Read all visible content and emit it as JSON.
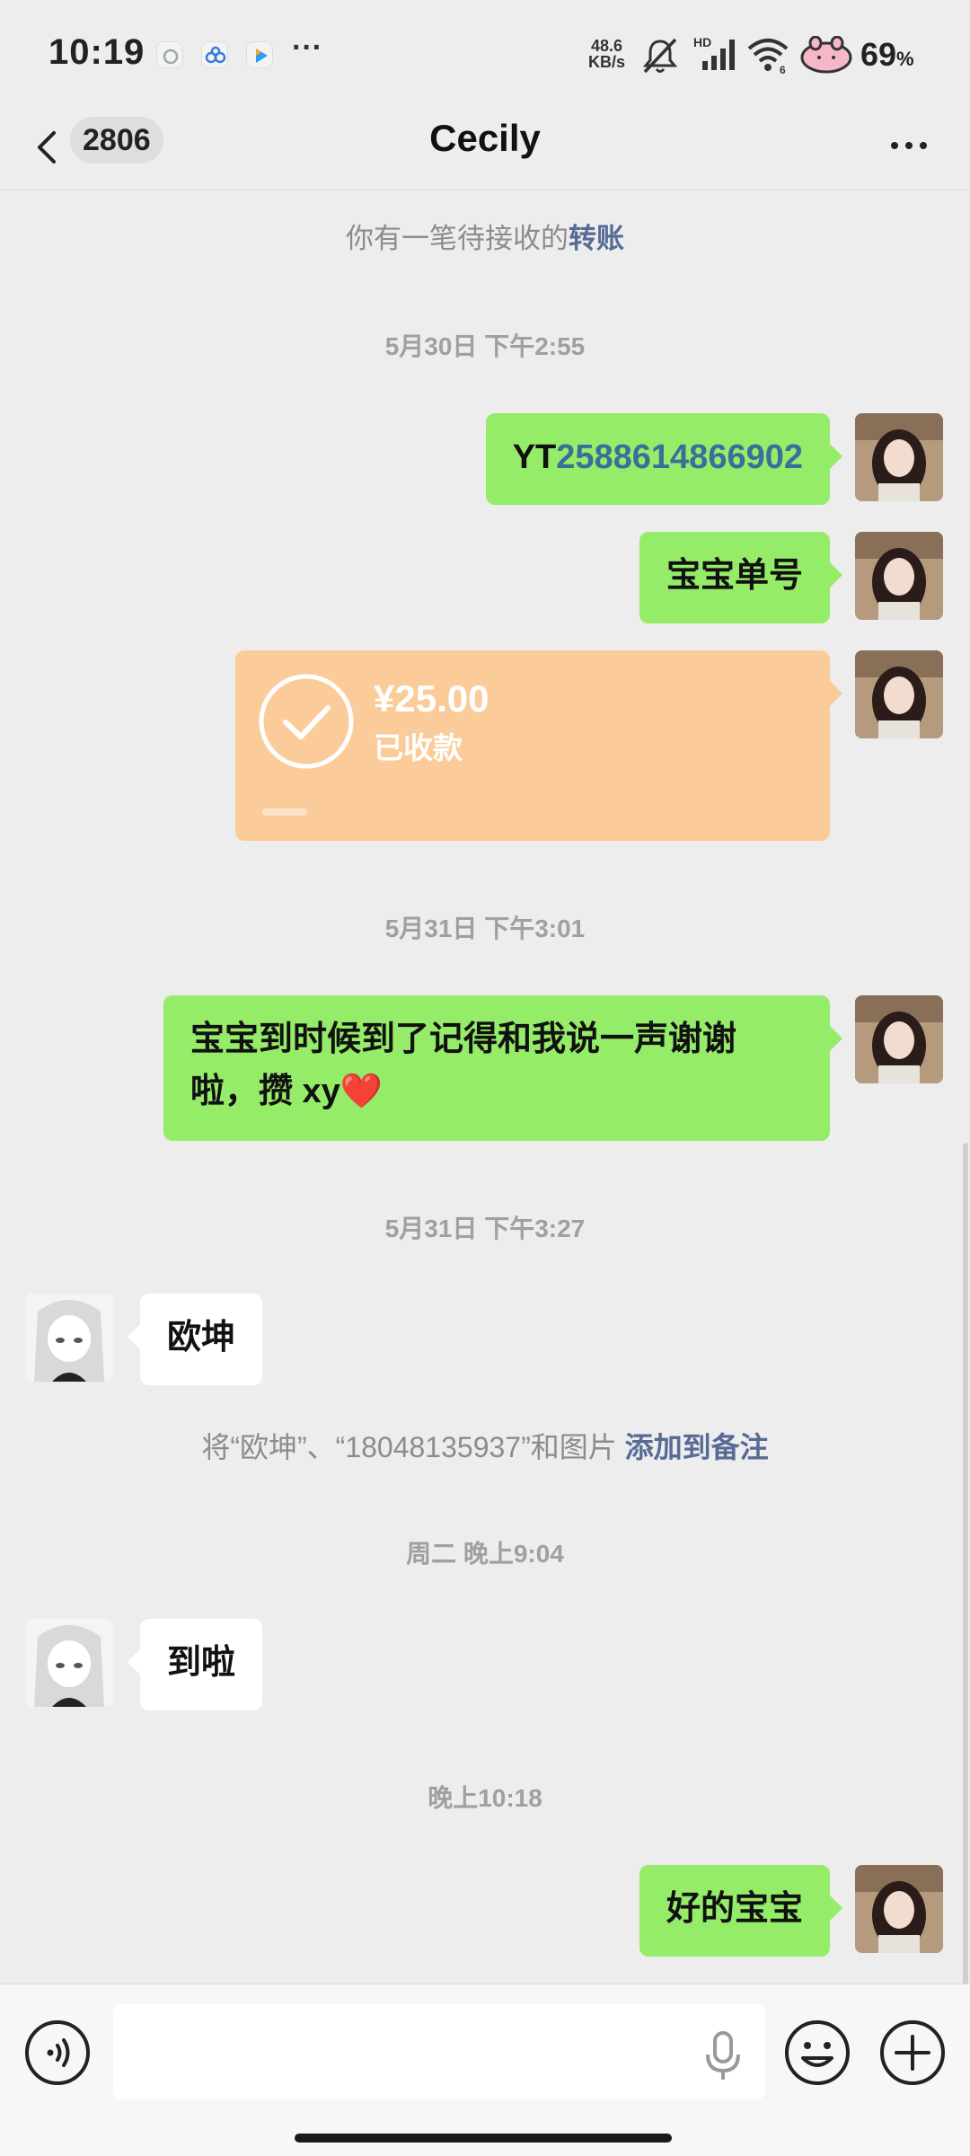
{
  "status_bar": {
    "time": "10:19",
    "more": "···",
    "net_speed_value": "48.6",
    "net_speed_unit": "KB/s",
    "battery": "69",
    "battery_unit": "%",
    "icons": [
      "weibo-app-icon",
      "baidu-cloud-icon",
      "video-app-icon",
      "mute-icon",
      "hd-signal-icon",
      "wifi-icon",
      "battery-icon"
    ]
  },
  "header": {
    "unread_count": "2806",
    "title": "Cecily"
  },
  "chat": {
    "pending_transfer_prefix": "你有一笔待接收的",
    "pending_transfer_link": "转账",
    "timestamps": [
      "5月30日 下午2:55",
      "5月31日 下午3:01",
      "5月31日 下午3:27",
      "周二 晚上9:04",
      "晚上10:18"
    ],
    "messages": [
      {
        "from": "me",
        "prefix": "YT",
        "number": "2588614866902"
      },
      {
        "from": "me",
        "text": "宝宝单号"
      },
      {
        "from": "me",
        "type": "transfer",
        "amount": "¥25.00",
        "status": "已收款"
      },
      {
        "from": "me",
        "line1": "宝宝到时候到了记得和我说一声谢谢",
        "line2": "啦，攒 xy",
        "emoji": "❤️"
      },
      {
        "from": "them",
        "text": "欧坤"
      },
      {
        "from": "them",
        "text": "到啦"
      },
      {
        "from": "me",
        "text": "好的宝宝"
      }
    ],
    "remark_hint_text": "将“欧坤”、“18048135937”和图片 ",
    "remark_hint_link": "添加到备注"
  },
  "input_bar": {
    "placeholder": "",
    "icons": [
      "voice-mode-icon",
      "microphone-icon",
      "emoji-icon",
      "plus-icon"
    ]
  },
  "colors": {
    "background": "#ededed",
    "my_bubble": "#95ec69",
    "their_bubble": "#ffffff",
    "transfer_card": "#fbcc9a",
    "link": "#576b95"
  }
}
